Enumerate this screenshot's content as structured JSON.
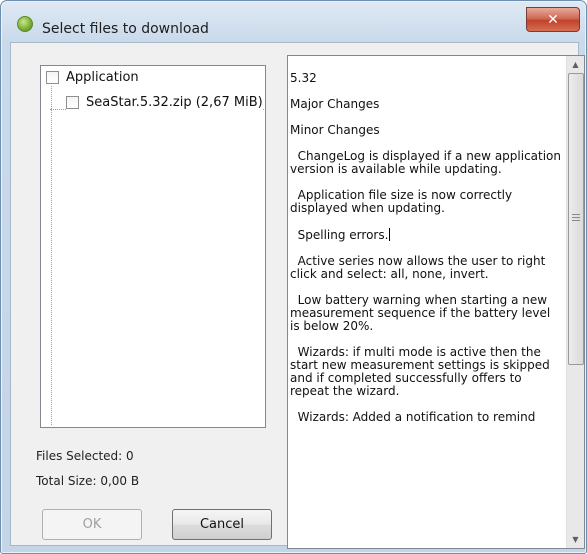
{
  "window": {
    "title": "Select files to download",
    "close_glyph": "✕"
  },
  "tree": {
    "root": {
      "label": "Application",
      "checked": false
    },
    "children": [
      {
        "label": "SeaStar.5.32.zip (2,67 MiB)",
        "checked": false
      }
    ]
  },
  "info": {
    "files_selected": "Files Selected: 0",
    "total_size": "Total Size: 0,00 B"
  },
  "buttons": {
    "ok": "OK",
    "cancel": "Cancel"
  },
  "notes": {
    "paragraphs": [
      "5.32",
      "Major Changes",
      "Minor Changes",
      "  ChangeLog is displayed if a new application version is available while updating.",
      "  Application file size is now correctly displayed when updating.",
      "  Spelling errors.",
      "  Active series now allows the user to right click and select: all, none, invert.",
      "  Low battery warning when starting a new measurement sequence if the battery level is below 20%.",
      "  Wizards: if multi mode is active then the start new measurement settings is skipped and if completed successfully offers to repeat the wizard.",
      "  Wizards: Added a notification to remind"
    ]
  },
  "scrollbar": {
    "up": "▲",
    "down": "▼"
  }
}
